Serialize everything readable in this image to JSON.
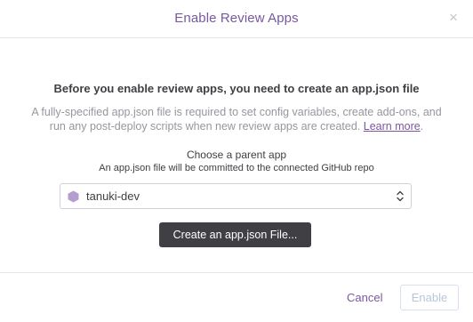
{
  "modal": {
    "title": "Enable Review Apps",
    "close_symbol": "×"
  },
  "body": {
    "headline": "Before you enable review apps, you need to create an app.json file",
    "description": "A fully-specified app.json file is required to set config variables, create add-ons, and run any post-deploy scripts when new review apps are created.",
    "learn_more_label": "Learn more",
    "description_end": ".",
    "parent_label": "Choose a parent app",
    "parent_sub": "An app.json file will be committed to the connected GitHub repo",
    "parent_app": {
      "selected_value": "tanuki-dev",
      "icon": "app-hexagon-icon"
    },
    "create_button_label": "Create an app.json File..."
  },
  "footer": {
    "cancel_label": "Cancel",
    "enable_label": "Enable"
  },
  "colors": {
    "accent": "#79589f",
    "dark_button": "#3f3f44",
    "text_muted": "#96969f",
    "disabled_text": "#b9c6d8"
  }
}
